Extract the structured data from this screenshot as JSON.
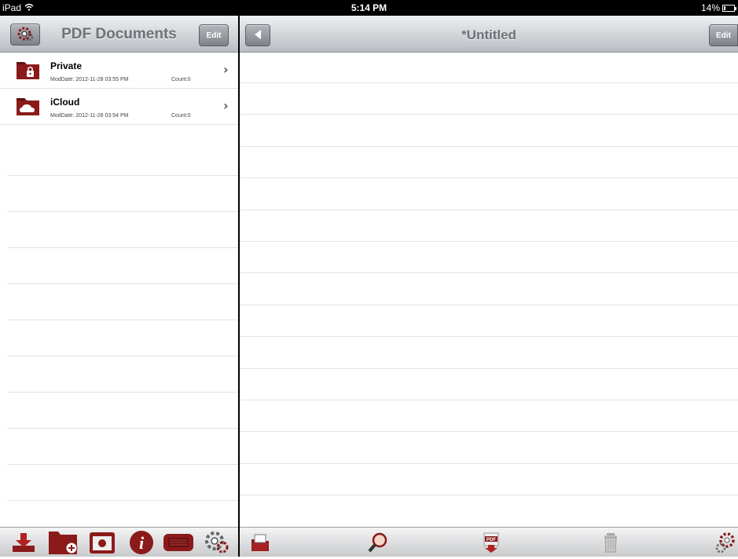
{
  "status_bar": {
    "device": "iPad",
    "time": "5:14 PM",
    "battery": "14%",
    "battery_level": 0.14
  },
  "left_nav": {
    "title": "PDF Documents",
    "edit_label": "Edit",
    "settings_icon": "gear-icon"
  },
  "files": [
    {
      "name": "Private",
      "mod_date": "ModDate: 2012-11-28 03:55 PM",
      "count": "Count:0",
      "icon": "locked-folder-icon"
    },
    {
      "name": "iCloud",
      "mod_date": "ModDate: 2012-11-28 03:54 PM",
      "count": "Count:0",
      "icon": "cloud-folder-icon"
    }
  ],
  "left_toolbar": [
    "import-download-icon",
    "new-folder-icon",
    "camera-icon",
    "info-icon",
    "keyboard-icon",
    "gear-icon"
  ],
  "right_nav": {
    "title": "*Untitled",
    "edit_label": "Edit",
    "back_icon": "back-arrow-icon"
  },
  "right_toolbar": [
    "folder-icon",
    "magnifier-icon",
    "pdf-export-icon",
    "trash-icon",
    "gear-icon"
  ],
  "colors": {
    "accent_red": "#8b1a1a",
    "nav_gradient_top": "#eef0f2",
    "nav_gradient_bottom": "#b9bdc2"
  }
}
